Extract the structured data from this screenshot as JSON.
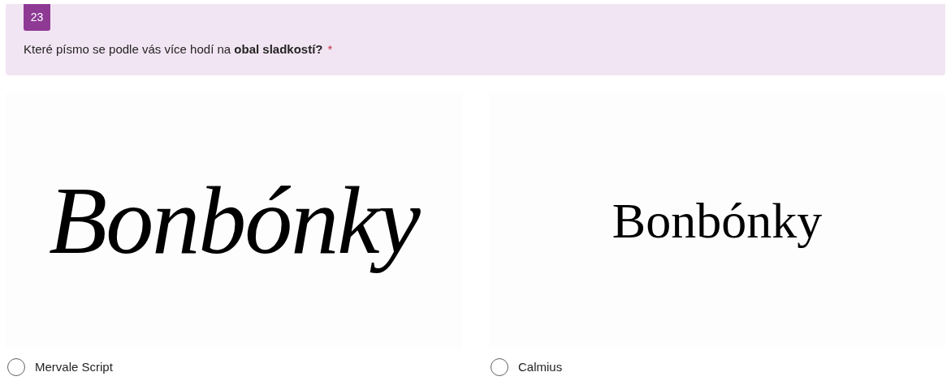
{
  "question": {
    "number": "23",
    "text": "Které písmo se podle vás více hodí na **obal sladkostí?**",
    "required_mark": "*"
  },
  "options": [
    {
      "kind": "script",
      "sample": "Bonbónky",
      "label": "Mervale Script",
      "selected": false
    },
    {
      "kind": "serif",
      "sample": "Bonbónky",
      "label": "Calmius",
      "selected": false
    }
  ]
}
